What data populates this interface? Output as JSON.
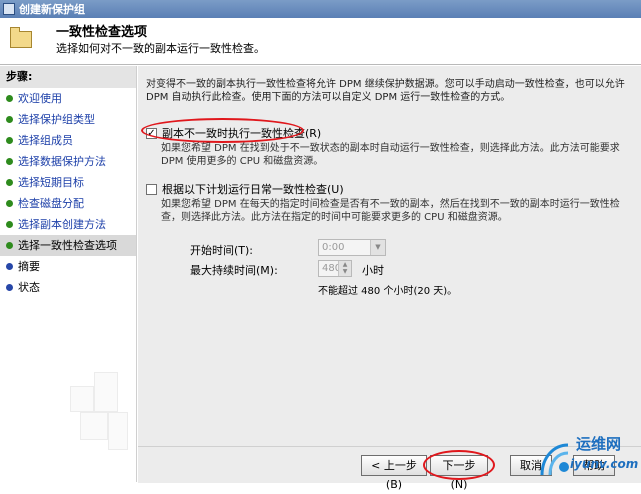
{
  "window": {
    "title": "创建新保护组"
  },
  "header": {
    "title": "一致性检查选项",
    "subtitle": "选择如何对不一致的副本运行一致性检查。"
  },
  "sidebar": {
    "steps_label": "步骤:",
    "items": [
      {
        "label": "欢迎使用",
        "state": "done"
      },
      {
        "label": "选择保护组类型",
        "state": "done"
      },
      {
        "label": "选择组成员",
        "state": "done"
      },
      {
        "label": "选择数据保护方法",
        "state": "done"
      },
      {
        "label": "选择短期目标",
        "state": "done"
      },
      {
        "label": "检查磁盘分配",
        "state": "done"
      },
      {
        "label": "选择副本创建方法",
        "state": "done"
      },
      {
        "label": "选择一致性检查选项",
        "state": "current"
      },
      {
        "label": "摘要",
        "state": "pending"
      },
      {
        "label": "状态",
        "state": "pending"
      }
    ]
  },
  "main": {
    "intro": "对变得不一致的副本执行一致性检查将允许 DPM 继续保护数据源。您可以手动启动一致性检查，也可以允许 DPM 自动执行此检查。使用下面的方法可以自定义 DPM 运行一致性检查的方式。",
    "option1": {
      "label": "副本不一致时执行一致性检查(R)",
      "checked": true,
      "description": "如果您希望 DPM 在找到处于不一致状态的副本时自动运行一致性检查，则选择此方法。此方法可能要求 DPM 使用更多的 CPU 和磁盘资源。"
    },
    "option2": {
      "label": "根据以下计划运行日常一致性检查(U)",
      "checked": false,
      "description": "如果您希望 DPM 在每天的指定时间检查是否有不一致的副本，然后在找到不一致的副本时运行一致性检查，则选择此方法。此方法在指定的时间中可能要求更多的 CPU 和磁盘资源。"
    },
    "start_time_label": "开始时间(T):",
    "start_time_value": "0:00",
    "max_duration_label": "最大持续时间(M):",
    "max_duration_value": "480",
    "max_duration_unit": "小时",
    "limit_note": "不能超过 480 个小时(20 天)。"
  },
  "footer": {
    "back_label": "< 上一步(B)",
    "next_label": "下一步(N)",
    "cancel_label": "取消",
    "help_label": "帮助"
  },
  "watermark": {
    "brand": "运维网",
    "site": "iyunv.com"
  },
  "colors": {
    "annotation_red": "#e0171c",
    "completed_dot": "#2e8b1d",
    "pending_dot": "#2747a8"
  }
}
